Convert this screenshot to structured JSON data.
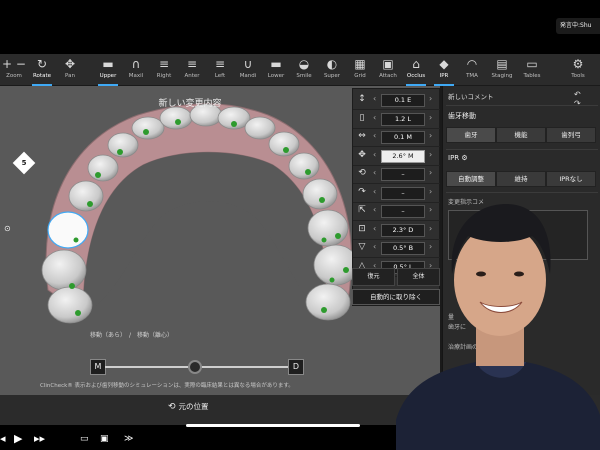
{
  "meeting": {
    "speaker_chip": "発言中:Shu"
  },
  "toolbar": {
    "tools": [
      {
        "label": "Zoom",
        "icon": "+ −"
      },
      {
        "label": "Rotate",
        "icon": "↻",
        "active": true
      },
      {
        "label": "Pan",
        "icon": "✥"
      },
      {
        "label": "Upper",
        "icon": "▬",
        "active": true
      },
      {
        "label": "Maxil",
        "icon": "∩"
      },
      {
        "label": "Right",
        "icon": "≡"
      },
      {
        "label": "Anter",
        "icon": "≡"
      },
      {
        "label": "Left",
        "icon": "≡"
      },
      {
        "label": "Mandi",
        "icon": "∪"
      },
      {
        "label": "Lower",
        "icon": "▬"
      },
      {
        "label": "Smile",
        "icon": "◒"
      },
      {
        "label": "Super",
        "icon": "◐"
      },
      {
        "label": "Grid",
        "icon": "▦"
      },
      {
        "label": "Attach",
        "icon": "▣"
      },
      {
        "label": "Occlus",
        "icon": "⌂",
        "active": true
      },
      {
        "label": "IPR",
        "icon": "◆",
        "active": true
      },
      {
        "label": "TMA",
        "icon": "◠"
      },
      {
        "label": "Staging",
        "icon": "▤"
      },
      {
        "label": "Tables",
        "icon": "▭"
      },
      {
        "label": "Tools",
        "icon": "⚙"
      }
    ]
  },
  "viewport": {
    "title": "新しい変更内容",
    "badge": "5",
    "compare_label": "移動（あら）　/　移動（離心）",
    "m_label": "M",
    "d_label": "D",
    "note": "ClinCheck® 表示および歯列移動のシミュレーションは、実際の臨床結果とは異なる場合があります。"
  },
  "numeric_panel": {
    "rows": [
      {
        "icon": "↕",
        "value": "0.1 E"
      },
      {
        "icon": "▯",
        "value": "1.2 L"
      },
      {
        "icon": "⇔",
        "value": "0.1 M"
      },
      {
        "icon": "✥",
        "value": "2.6°  M",
        "highlight": true
      },
      {
        "icon": "⟲",
        "value": "–"
      },
      {
        "icon": "↷",
        "value": "–"
      },
      {
        "icon": "⇱",
        "value": "–"
      },
      {
        "icon": "⊡",
        "value": "2.3° D"
      },
      {
        "icon": "▽",
        "value": "0.5° B"
      },
      {
        "icon": "△",
        "value": "0.5° L"
      }
    ],
    "btn_left": "復元",
    "btn_right": "全体",
    "auto_remove": "自動的に取り除く"
  },
  "right_panel": {
    "header": "新しいコメント",
    "tooth_move": "歯牙移動",
    "tooth_tabs": [
      "歯牙",
      "機能",
      "歯列弓"
    ],
    "ipr_title": "IPR",
    "ipr_tabs": [
      "自動調整",
      "維持",
      "IPRなし"
    ],
    "change_comment": "変更指示コメ",
    "hint_1": "量",
    "hint_2": "歯牙に",
    "add_plan": "治療計画の作成"
  },
  "statusbar": {
    "reset_label": "元の位置"
  },
  "colors": {
    "accent": "#3fa9f5",
    "attachment": "#2e9b2e"
  }
}
